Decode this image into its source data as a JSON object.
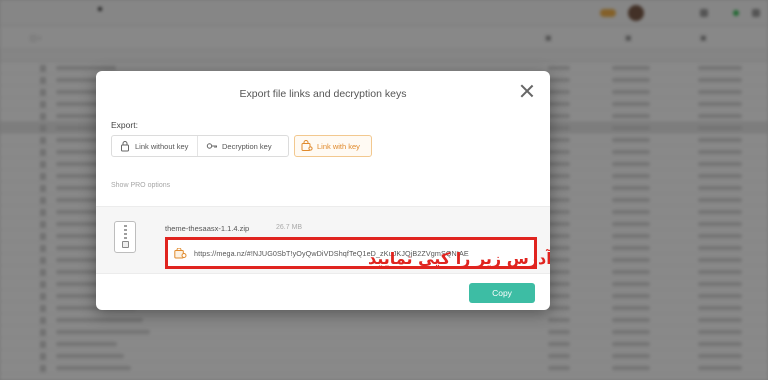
{
  "dialog": {
    "title": "Export file links and decryption keys",
    "export_label": "Export:",
    "options": [
      {
        "label": "Link without key",
        "icon": "lock-icon",
        "selected": false
      },
      {
        "label": "Decryption key",
        "icon": "key-icon",
        "selected": false
      },
      {
        "label": "Link with key",
        "icon": "link-lock-icon",
        "selected": true
      }
    ],
    "show_pro": "Show PRO options",
    "file": {
      "name": "theme-thesaasx-1.1.4.zip",
      "size": "26.7 MB",
      "link": "https://mega.nz/#!NJUG0SbT!yOyQwDiVDShqfTeQ1eD_zKuJKJQjB2ZVgmSQNIAE"
    },
    "copy_label": "Copy"
  },
  "annotation": {
    "text": "آدرس زیر را کپی نمایید",
    "color": "#e0241f"
  },
  "colors": {
    "accent": "#3dbda4",
    "highlight": "#e0241f",
    "selected_option": "#e08a2c"
  }
}
